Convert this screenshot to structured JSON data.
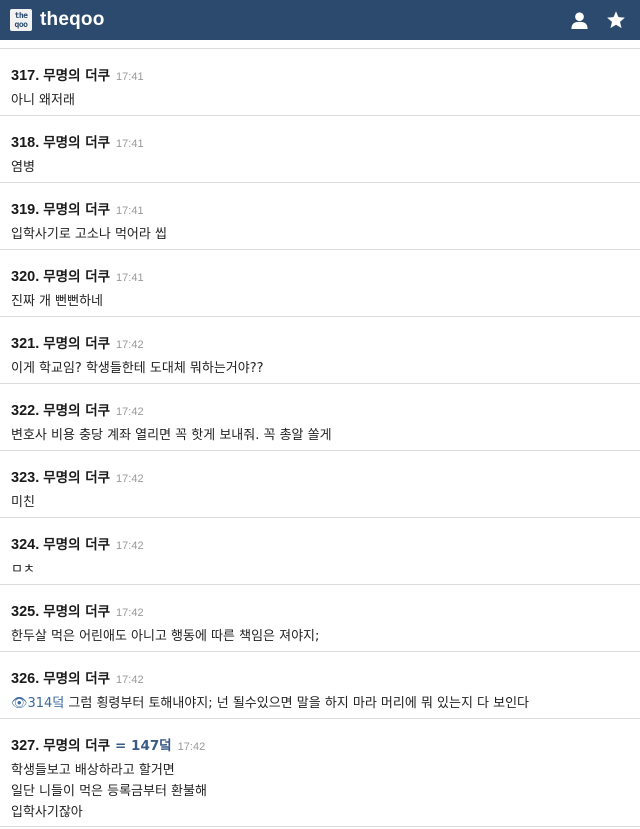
{
  "header": {
    "logo_top": "the",
    "logo_bottom": "qoo",
    "brand": "theqoo",
    "colors": {
      "bar": "#2b4a6e"
    },
    "icons": [
      "user-icon",
      "star-icon"
    ]
  },
  "comments": [
    {
      "num": "317.",
      "author": "무명의 더쿠",
      "time": "17:41",
      "lines": [
        "아니 왜저래"
      ]
    },
    {
      "num": "318.",
      "author": "무명의 더쿠",
      "time": "17:41",
      "lines": [
        "염병"
      ]
    },
    {
      "num": "319.",
      "author": "무명의 더쿠",
      "time": "17:41",
      "lines": [
        "입학사기로 고소나 먹어라 씹"
      ]
    },
    {
      "num": "320.",
      "author": "무명의 더쿠",
      "time": "17:41",
      "lines": [
        "진짜 개 뻔뻔하네"
      ]
    },
    {
      "num": "321.",
      "author": "무명의 더쿠",
      "time": "17:42",
      "lines": [
        "이게 학교임? 학생들한테 도대체 뭐하는거야??"
      ]
    },
    {
      "num": "322.",
      "author": "무명의 더쿠",
      "time": "17:42",
      "lines": [
        "변호사 비용 충당 계좌 열리면 꼭 핫게 보내줘. 꼭 총알 쏠게"
      ]
    },
    {
      "num": "323.",
      "author": "무명의 더쿠",
      "time": "17:42",
      "lines": [
        "미친"
      ]
    },
    {
      "num": "324.",
      "author": "무명의 더쿠",
      "time": "17:42",
      "lines": [
        "ㅁㅊ"
      ]
    },
    {
      "num": "325.",
      "author": "무명의 더쿠",
      "time": "17:42",
      "lines": [
        "한두살 먹은 어린애도 아니고 행동에 따른 책임은 져야지;"
      ]
    },
    {
      "num": "326.",
      "author": "무명의 더쿠",
      "time": "17:42",
      "reply": "👁314덬",
      "lines": [
        " 그럼 횡령부터 토해내야지; 넌 될수있으면 말을 하지 마라 머리에 뭐 있는지 다 보인다"
      ]
    },
    {
      "num": "327.",
      "author": "무명의 더쿠",
      "eq": "= 147덬",
      "time": "17:42",
      "lines": [
        "학생들보고 배상하라고 할거면",
        "일단 니들이 먹은 등록금부터 환불해",
        "입학사기잖아"
      ]
    }
  ]
}
